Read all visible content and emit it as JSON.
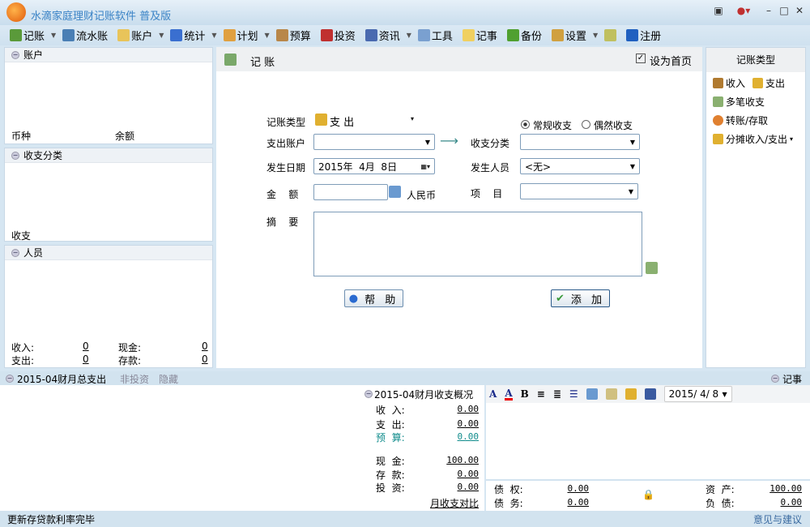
{
  "app": {
    "title": "水滴家庭理财记账软件  普及版"
  },
  "toolbar": [
    {
      "label": "记账",
      "icon": "pen-book-icon",
      "dropdown": true,
      "color": "#5a9a3a"
    },
    {
      "label": "流水账",
      "icon": "ledger-icon",
      "dropdown": false,
      "color": "#4a7fb5"
    },
    {
      "label": "账户",
      "icon": "folder-lock-icon",
      "dropdown": true,
      "color": "#e8c45a"
    },
    {
      "label": "统计",
      "icon": "bar-chart-icon",
      "dropdown": true,
      "color": "#3a6fd0"
    },
    {
      "label": "计划",
      "icon": "calendar-icon",
      "dropdown": true,
      "color": "#e0a040"
    },
    {
      "label": "预算",
      "icon": "budget-icon",
      "dropdown": false,
      "color": "#b8874a"
    },
    {
      "label": "投资",
      "icon": "line-chart-icon",
      "dropdown": false,
      "color": "#c03030"
    },
    {
      "label": "资讯",
      "icon": "news-icon",
      "dropdown": true,
      "color": "#4a6ab0"
    },
    {
      "label": "工具",
      "icon": "tools-icon",
      "dropdown": false,
      "color": "#7aa0d0"
    },
    {
      "label": "记事",
      "icon": "note-icon",
      "dropdown": false,
      "color": "#f0d060"
    },
    {
      "label": "备份",
      "icon": "backup-icon",
      "dropdown": false,
      "color": "#50a030"
    },
    {
      "label": "设置",
      "icon": "settings-icon",
      "dropdown": true,
      "color": "#d0a040"
    },
    {
      "label": "",
      "icon": "calculator-icon",
      "dropdown": false,
      "color": "#c0c060"
    },
    {
      "label": "注册",
      "icon": "help-icon",
      "dropdown": false,
      "color": "#2060c0"
    }
  ],
  "left": {
    "accounts": {
      "title": "账户",
      "col1": "币种",
      "col2": "余额"
    },
    "categories": {
      "title": "收支分类",
      "col1": "收支"
    },
    "persons": {
      "title": "人员"
    },
    "stats": {
      "income_label": "收入:",
      "income": "0",
      "cash_label": "现金:",
      "cash": "0",
      "expense_label": "支出:",
      "expense": "0",
      "deposit_label": "存款:",
      "deposit": "0"
    }
  },
  "main": {
    "header": "记 账",
    "homepage_label": "设为首页",
    "homepage_checked": true,
    "type_label": "记账类型",
    "type_value": "支 出",
    "regular_label": "常规收支",
    "occasional_label": "偶然收支",
    "account_label": "支出账户",
    "account_value": "",
    "category_label": "收支分类",
    "category_value": "",
    "date_label": "发生日期",
    "date_value": "2015年  4月  8日",
    "person_label": "发生人员",
    "person_value": "<无>",
    "amount_label": "金    额",
    "amount_value": "",
    "currency": "人民币",
    "project_label": "项    目",
    "project_value": "",
    "summary_label": "摘    要",
    "summary_value": "",
    "help_button": "帮 助",
    "add_button": "添 加"
  },
  "right": {
    "title": "记账类型",
    "items": [
      {
        "label": "收入",
        "extra": "支出"
      },
      {
        "label": "多笔收支"
      },
      {
        "label": "转账/存取"
      },
      {
        "label": "分摊收入/支出"
      }
    ]
  },
  "bottom": {
    "tab_title": "2015-04财月总支出",
    "tab_noninvest": "非投资",
    "tab_hide": "隐藏",
    "notes_title": "记事",
    "summary": {
      "title": "2015-04财月收支概况",
      "rows": [
        {
          "label": "收  入:",
          "value": "0.00"
        },
        {
          "label": "支  出:",
          "value": "0.00"
        },
        {
          "label": "预  算:",
          "value": "0.00"
        }
      ],
      "rows2": [
        {
          "label": "现  金:",
          "value": "100.00"
        },
        {
          "label": "存  款:",
          "value": "0.00"
        },
        {
          "label": "投  资:",
          "value": "0.00"
        }
      ],
      "compare_link": "月收支对比"
    },
    "notes_date": "2015/ 4/ 8",
    "claims_label": "债  权:",
    "claims": "0.00",
    "debts_label": "债  务:",
    "debts": "0.00",
    "assets_label": "资  产:",
    "assets": "100.00",
    "liabilities_label": "负  债:",
    "liabilities": "0.00"
  },
  "status": {
    "text": "更新存贷款利率完毕",
    "feedback": "意见与建议"
  }
}
